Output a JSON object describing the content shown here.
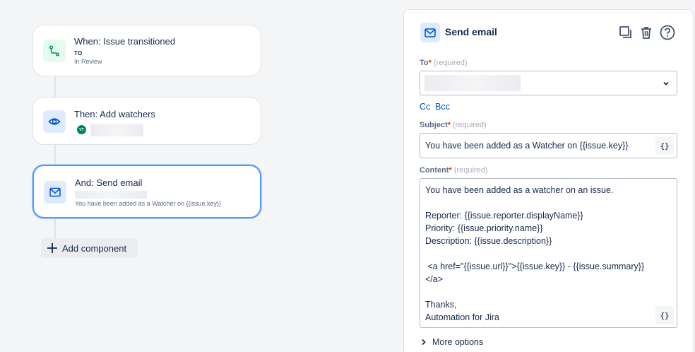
{
  "flow": {
    "trigger": {
      "title": "When: Issue transitioned",
      "to_label": "TO",
      "status": "In Review"
    },
    "action_watchers": {
      "title": "Then: Add watchers",
      "avatar_initials": "VT"
    },
    "action_email": {
      "title": "And: Send email",
      "preview": "You have been added as a Watcher on {{issue.key}}"
    },
    "add_component_label": "Add component"
  },
  "panel": {
    "title": "Send email",
    "to": {
      "label": "To",
      "required_star": "*",
      "required_hint": "(required)"
    },
    "cc_label": "Cc",
    "bcc_label": "Bcc",
    "subject": {
      "label": "Subject",
      "required_star": "*",
      "required_hint": "(required)",
      "value": "You have been added as a Watcher on {{issue.key}}"
    },
    "content": {
      "label": "Content",
      "required_star": "*",
      "required_hint": "(required)",
      "value": "You have been added as a watcher on an issue.\n\nReporter: {{issue.reporter.displayName}}\nPriority: {{issue.priority.name}}\nDescription: {{issue.description}}\n\n <a href=\"{{issue.url}}\">{{issue.key}} - {{issue.summary}}\n</a>\n\nThanks,\nAutomation for Jira"
    },
    "smart_value_label": "{}",
    "more_options_label": "More options"
  },
  "icons": {
    "trigger": "branch-icon",
    "watchers": "eye-icon",
    "email": "mail-icon",
    "add": "plus-icon",
    "duplicate": "copy-icon",
    "delete": "trash-icon",
    "help": "help-icon",
    "dropdown": "chevron-down-icon",
    "expand": "chevron-right-icon"
  },
  "colors": {
    "accent": "#0052cc",
    "selected_border": "#4c9aff",
    "trigger_icon": "#00875a",
    "required": "#de350b"
  }
}
